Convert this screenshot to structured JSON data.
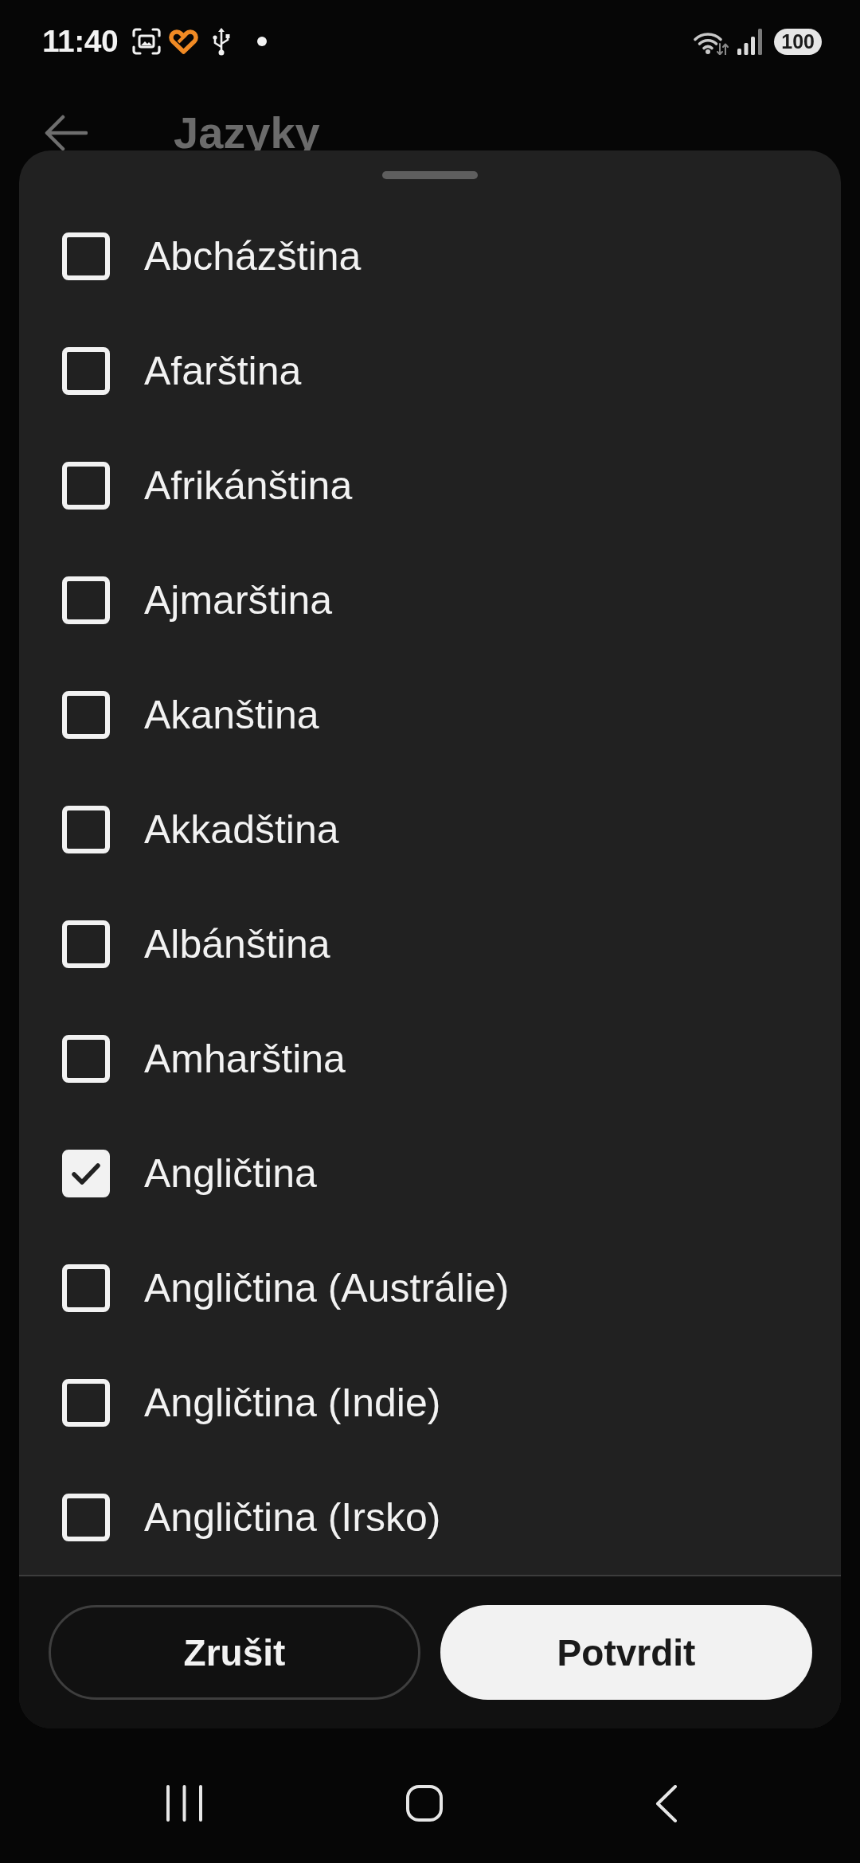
{
  "status_bar": {
    "time": "11:40",
    "battery": "100"
  },
  "header": {
    "title": "Jazyky"
  },
  "sheet": {
    "items": [
      {
        "label": "Abcházština",
        "checked": false
      },
      {
        "label": "Afarština",
        "checked": false
      },
      {
        "label": "Afrikánština",
        "checked": false
      },
      {
        "label": "Ajmarština",
        "checked": false
      },
      {
        "label": "Akanština",
        "checked": false
      },
      {
        "label": "Akkadština",
        "checked": false
      },
      {
        "label": "Albánština",
        "checked": false
      },
      {
        "label": "Amharština",
        "checked": false
      },
      {
        "label": "Angličtina",
        "checked": true
      },
      {
        "label": "Angličtina (Austrálie)",
        "checked": false
      },
      {
        "label": "Angličtina (Indie)",
        "checked": false
      },
      {
        "label": "Angličtina (Irsko)",
        "checked": false
      }
    ],
    "buttons": [
      {
        "label": "Zrušit",
        "kind": "outlined"
      },
      {
        "label": "Potvrdit",
        "kind": "filled"
      }
    ]
  }
}
